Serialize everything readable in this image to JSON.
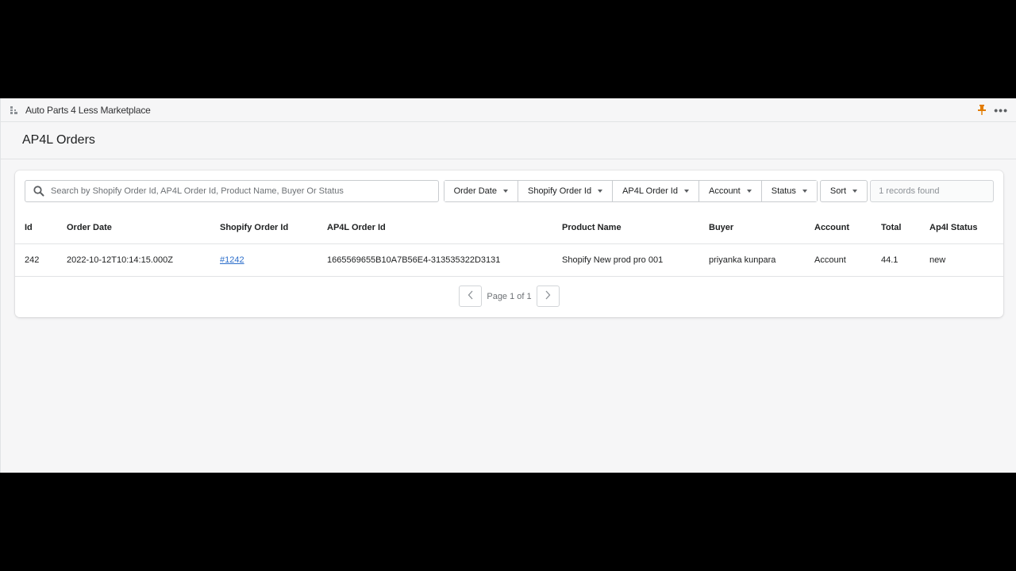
{
  "app": {
    "title": "Auto Parts 4 Less Marketplace",
    "icons": {
      "app": "app-grid-icon",
      "pin": "pin-icon",
      "more": "more-horizontal-icon"
    },
    "more_label": "•••",
    "pin_color": "#e27c00"
  },
  "page": {
    "title": "AP4L Orders"
  },
  "filters": {
    "search_placeholder": "Search by Shopify Order Id, AP4L Order Id, Product Name, Buyer Or Status",
    "search_value": "",
    "buttons": [
      {
        "label": "Order Date"
      },
      {
        "label": "Shopify Order Id"
      },
      {
        "label": "AP4L Order Id"
      },
      {
        "label": "Account"
      },
      {
        "label": "Status"
      }
    ],
    "sort_label": "Sort",
    "records_found": "1 records found"
  },
  "table": {
    "columns": [
      "Id",
      "Order Date",
      "Shopify Order Id",
      "AP4L Order Id",
      "Product Name",
      "Buyer",
      "Account",
      "Total",
      "Ap4l Status"
    ],
    "rows": [
      {
        "id": "242",
        "order_date": "2022-10-12T10:14:15.000Z",
        "shopify_order_id": "#1242",
        "ap4l_order_id": "1665569655B10A7B56E4-313535322D3131",
        "product_name": "Shopify New prod pro 001",
        "buyer": "priyanka kunpara",
        "account": "Account",
        "total": "44.1",
        "ap4l_status": "new"
      }
    ]
  },
  "pagination": {
    "label": "Page 1 of 1"
  }
}
